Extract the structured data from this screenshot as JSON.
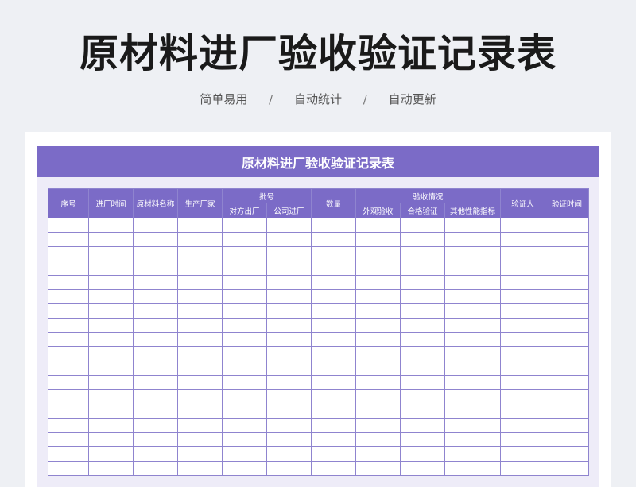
{
  "title": "原材料进厂验收验证记录表",
  "subtitle": {
    "items": [
      "简单易用",
      "自动统计",
      "自动更新"
    ],
    "separator": "/"
  },
  "sheet": {
    "title": "原材料进厂验收验证记录表",
    "headers": {
      "seq": "序号",
      "entry_time": "进厂时间",
      "material_name": "原材料名称",
      "manufacturer": "生产厂家",
      "batch": "批号",
      "batch_sub": [
        "对方出厂",
        "公司进厂"
      ],
      "quantity": "数量",
      "inspection": "验收情况",
      "inspection_sub": [
        "外观验收",
        "合格验证",
        "其他性能指标"
      ],
      "verifier": "验证人",
      "verify_time": "验证时间"
    },
    "empty_rows": 18
  },
  "colors": {
    "accent": "#7b6bc7",
    "sheet_bg": "#eeecf8",
    "page_bg": "#eef0f4"
  }
}
